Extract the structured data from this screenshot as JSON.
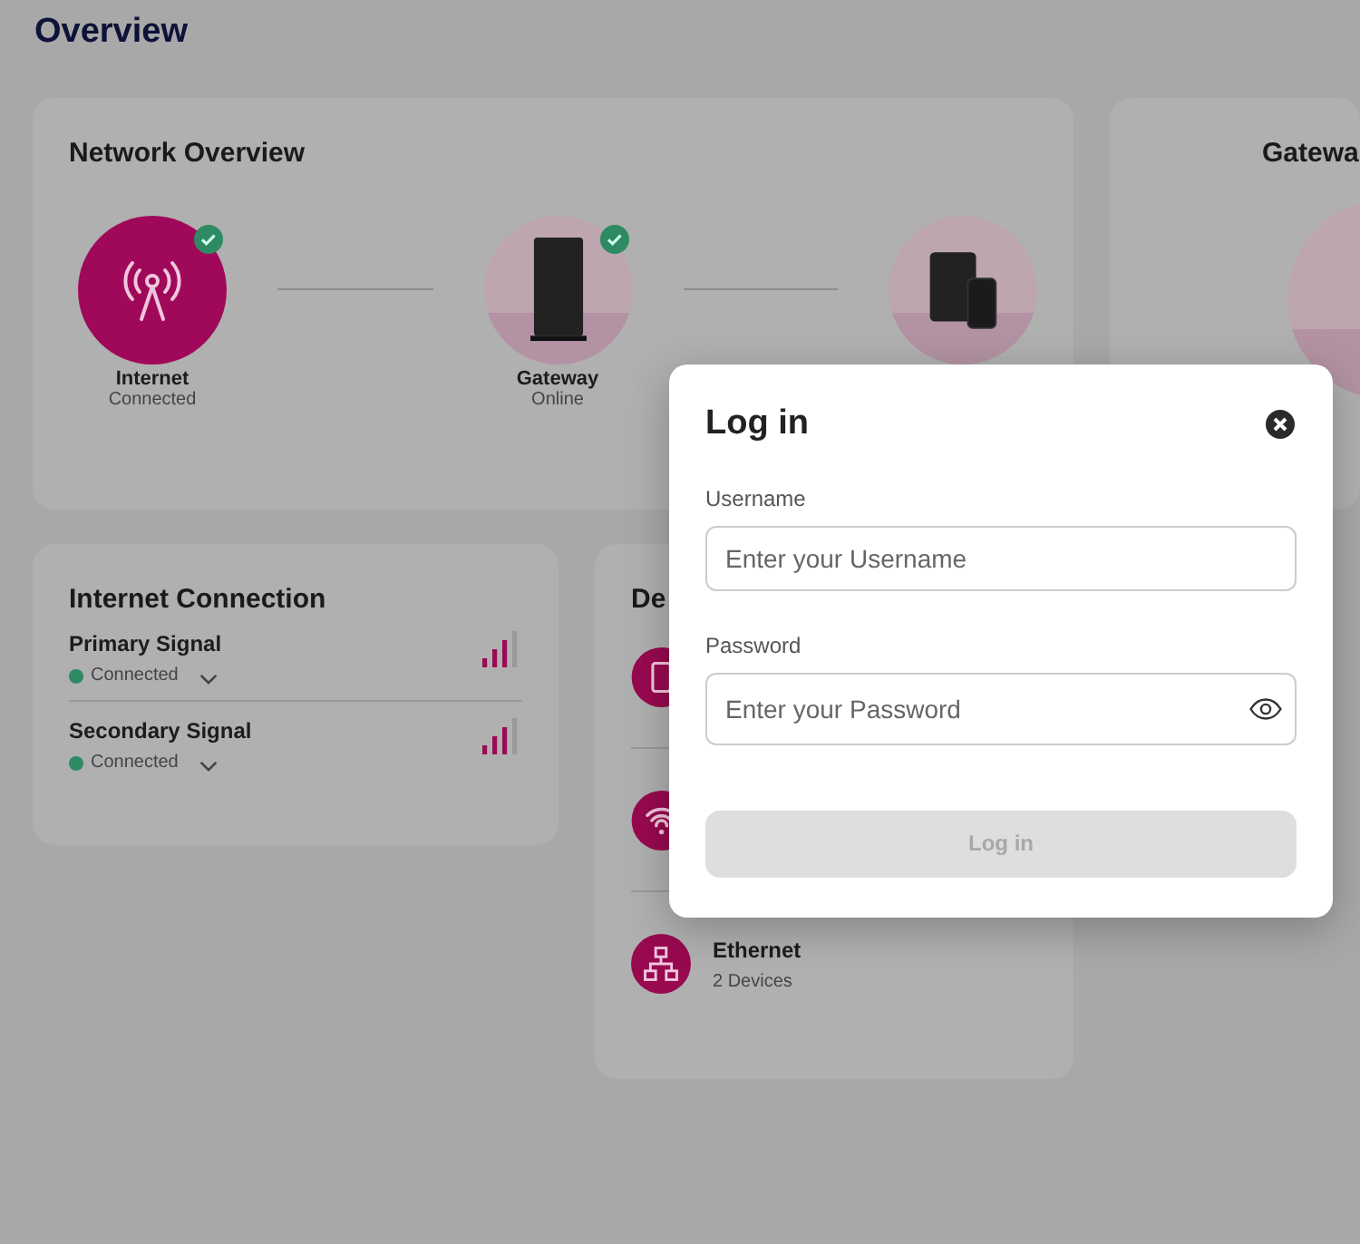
{
  "page_title": "Overview",
  "network_overview": {
    "title": "Network Overview",
    "nodes": [
      {
        "kind": "internet",
        "label": "Internet",
        "status": "Connected",
        "verified": true
      },
      {
        "kind": "gateway",
        "label": "Gateway",
        "status": "Online",
        "verified": true
      },
      {
        "kind": "devices",
        "verified": false
      }
    ]
  },
  "gateway_card": {
    "title": "Gatewa"
  },
  "internet_connection": {
    "title": "Internet Connection",
    "signals": [
      {
        "name": "Primary Signal",
        "status": "Connected"
      },
      {
        "name": "Secondary Signal",
        "status": "Connected"
      }
    ]
  },
  "devices": {
    "title": "De",
    "items": [
      {
        "kind": "phone"
      },
      {
        "kind": "wifi"
      },
      {
        "kind": "ethernet",
        "name": "Ethernet",
        "count": "2 Devices"
      }
    ]
  },
  "login_dialog": {
    "title": "Log in",
    "username_label": "Username",
    "username_placeholder": "Enter your Username",
    "password_label": "Password",
    "password_placeholder": "Enter your Password",
    "submit": "Log in",
    "submit_disabled": true
  }
}
